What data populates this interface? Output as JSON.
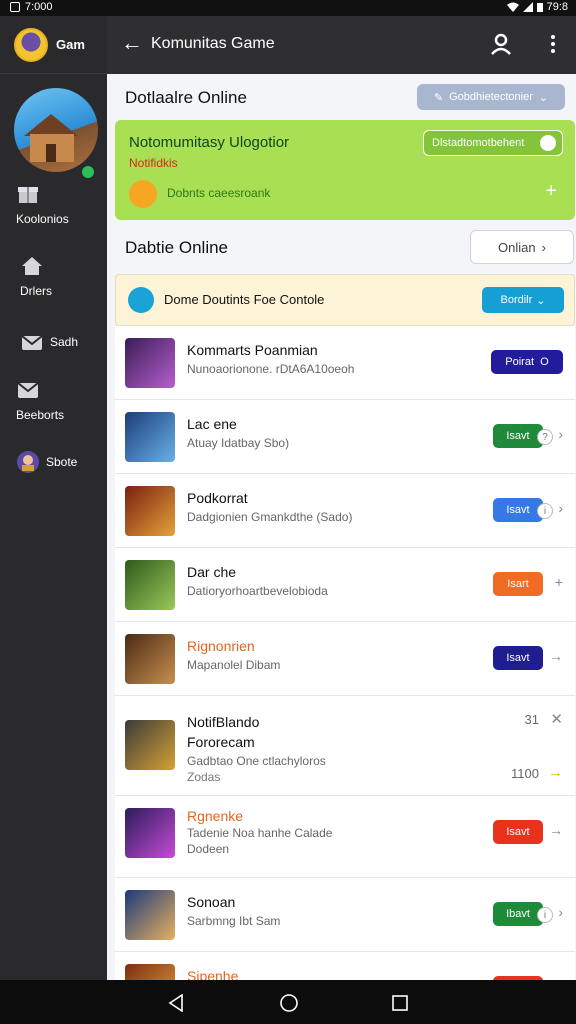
{
  "status": {
    "time": "7:000",
    "right_text": "79:8"
  },
  "sidebar": {
    "app_name": "Gam",
    "items": [
      {
        "label": "Koolonios",
        "icon": "gift-icon"
      },
      {
        "label": "Drlers",
        "icon": "home-icon"
      },
      {
        "label": "Sadh",
        "icon": "inbox-icon"
      },
      {
        "label": "Beeborts",
        "icon": "mail-icon"
      },
      {
        "label": "Sbote",
        "icon": "game-avatar-icon"
      }
    ]
  },
  "appbar": {
    "title": "Komunitas Game"
  },
  "header_section": {
    "title": "Dotlaalre Online",
    "filter_label": "Gobdhietectonier"
  },
  "promo_card": {
    "title": "Notomumitasy Ulogotior",
    "subtitle": "Notifidkis",
    "toggle_label": "Dlstadtomotbehent",
    "message": "Dobnts caeesroank"
  },
  "online_section": {
    "title": "Dabtie Online",
    "button_label": "Onlian"
  },
  "notice_bar": {
    "text": "Dome Doutints Foe Contole",
    "button_label": "Bordilr"
  },
  "rows": [
    {
      "name": "Kommarts Poanmian",
      "sub": "Nunoaorionone. rDtA6A10oeoh",
      "button": "Poirat",
      "status_icon": "O",
      "color": "#221c9c",
      "name_color": "default"
    },
    {
      "name": "Lac ene",
      "sub": "Atuay Idatbay Sbo)",
      "button": "Isavt",
      "color": "#1e8a3a",
      "name_color": "default"
    },
    {
      "name": "Podkorrat",
      "sub": "Dadgionien Gmankdthe (Sado)",
      "button": "Isavt",
      "color": "#3479e6",
      "name_color": "default"
    },
    {
      "name": "Dar che",
      "sub": "Datioryorhoartbevelobioda",
      "button": "Isart",
      "color": "#f06b24",
      "name_color": "default"
    },
    {
      "name": "Rignonrien",
      "sub": "Mapanolel Dibam",
      "button": "Isavt",
      "color": "#1e1e8e",
      "name_color": "orange"
    },
    {
      "name": "NotifBlando",
      "name2": "Fororecam",
      "sub": "Gadbtao One ctlachyloros",
      "sub2": "Zodas",
      "count": "31",
      "price": "1100"
    },
    {
      "name": "Rgnenke",
      "sub": "Tadenie Noa hanhe Calade",
      "sub2": "Dodeen",
      "button": "Isavt",
      "color": "#e8321c",
      "name_color": "orange"
    },
    {
      "name": "Sonoan",
      "sub": "Sarbmng Ibt Sam",
      "button": "Ibavt",
      "color": "#1e8a3a",
      "name_color": "default"
    },
    {
      "name": "Sipenhe",
      "sub": "",
      "button": "",
      "color": "#e8321c",
      "name_color": "orange"
    }
  ]
}
